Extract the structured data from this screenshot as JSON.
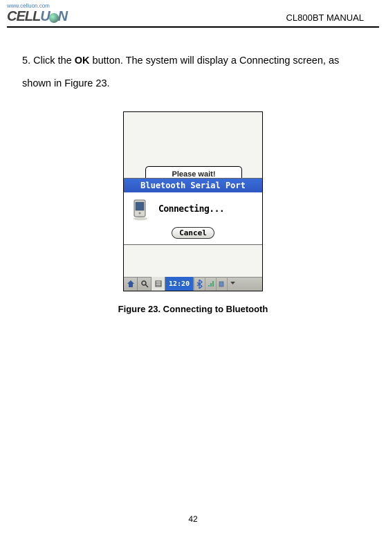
{
  "header": {
    "logo_url": "www.celluon.com",
    "logo_part1": "CELL",
    "logo_part2": "N",
    "manual_title": "CL800BT MANUAL"
  },
  "instruction": {
    "prefix": "5. Click the ",
    "bold": "OK",
    "rest": " button. The system will display a Connecting screen, as shown in Figure 23."
  },
  "screenshot": {
    "back_dialog_text": "Please wait!",
    "dialog_title": "Bluetooth Serial Port",
    "status_text": "Connecting...",
    "cancel_label": "Cancel",
    "taskbar": {
      "time": "12:20"
    }
  },
  "caption": "Figure 23. Connecting to Bluetooth",
  "page_number": "42"
}
